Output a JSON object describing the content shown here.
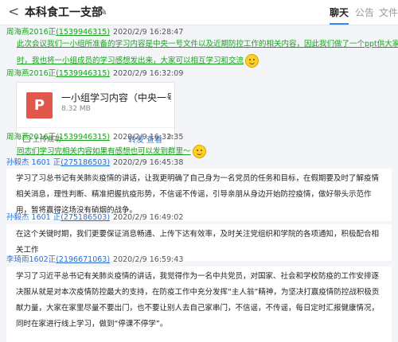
{
  "header": {
    "back_icon": "chevron-left-icon",
    "title": "本科食工一支部",
    "edit_icon": "pencil-edit-icon"
  },
  "tabs": [
    {
      "label": "聊天",
      "active": true
    },
    {
      "label": "公告",
      "active": false
    },
    {
      "label": "文件",
      "active": false
    }
  ],
  "colors": {
    "sender_highlight": "#19a31b",
    "sender": "#2a6fd6",
    "accent": "#2f8af5",
    "file_icon": "#e2574c"
  },
  "messages": [
    {
      "sender": "周海燕2016正",
      "id": "(1539946315)",
      "time": "2020/2/9 16:28:47",
      "lines": [
        "此次会议我们一小组所准备的学习内容是中央一号文件以及近期防控工作的相关内容，因此我们做了一个ppt供大家学习，同",
        "时，我也将一小组成员的学习感想发出来，大家可以相互学习和交流"
      ]
    },
    {
      "sender": "周海燕2016正",
      "id": "(1539946315)",
      "time": "2020/2/9 16:32:09",
      "file": {
        "icon_label": "P",
        "name": "一小组学习内容（中央一号文...",
        "size": "8.32 MB",
        "status": "上传成功",
        "forward": "转发",
        "view": "查看",
        "more": "≡"
      }
    },
    {
      "sender": "周海燕2016正",
      "id": "(1539946315)",
      "time": "2020/2/9 16:32:35",
      "lines": [
        "同志们学习完相关内容如果有感想也可以发到群里～"
      ]
    },
    {
      "sender": "孙毅杰 1601 正",
      "id": "(275186503)",
      "time": "2020/2/9 16:45:38",
      "text": "学习了习总书记有关肺炎疫情的讲话，让我更明确了自己身为一名党员的任务和目标，在假期要及时了解疫情相关消息，理性判断、精准把握抗疫形势，不信谣不传谣，引导亲朋从身边开始防控疫情，做好带头示范作用，暂将赢得这场没有硝烟的战争。"
    },
    {
      "sender": "孙毅杰 1601 正",
      "id": "(275186503)",
      "time": "2020/2/9 16:49:02",
      "text": "在这个关键时期，我们更要保证消息畅通、上传下达有效率，及时关注党组织和学院的各项通知，积极配合相关工作"
    },
    {
      "sender": "李琦雨1602正",
      "id": "(2196671063)",
      "time": "2020/2/9 16:59:43",
      "text": "学习了习近平总书记有关肺炎疫情的讲话，我觉得作为一名中共党员，对国家、社会和学校防疫的工作安排逐决服从就是对本次疫情防控最大的支持，在防疫工作中充分发挥“主人翁”精神，为坚决打赢疫情防控战积极贡献力量，大家在家里尽量不要出门，也不要让别人去自己家串门，不信谣，不传谣，每日定时汇报健康情况，同时在家进行线上学习，做到“停课不停学”。"
    }
  ]
}
